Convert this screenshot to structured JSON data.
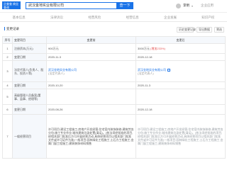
{
  "brand": {
    "logo_text": "企查查 商业查询",
    "accent": "#1a73e8"
  },
  "search": {
    "value": "武汉金地实业有限公司",
    "button_label": "查一下"
  },
  "user": {
    "name": "李明",
    "extra": "企业应用"
  },
  "tabs": [
    "基本信息",
    "法律诉讼",
    "经营风险",
    "经营信息",
    "企业发展",
    "知识产权"
  ],
  "section": {
    "title": "变更记录",
    "buttons": {
      "history": "历史变更记录",
      "export": "导出数据",
      "filter": "筛选"
    }
  },
  "table": {
    "headers": [
      "序号",
      "变更项目",
      "变更前",
      "变更后"
    ],
    "rows": [
      {
        "num": "1",
        "item": "注册资本(万元)",
        "before": "900万元",
        "after": "3000万元",
        "after_note": "(增加233%)"
      },
      {
        "num": "2",
        "item": "变更日期",
        "before": "2020-11-3",
        "after": "2020-12-18"
      },
      {
        "num": "3",
        "item": "法定代表人(负责人、股东、投资人等)",
        "before_link": "武汉金地实业有限公司",
        "before_sub": "(法定代表人)",
        "after_link": "武汉金地实业有限公司",
        "after_sub": "(法定代表人)"
      },
      {
        "num": "4",
        "item": "变更日期",
        "before": "2020-10-20",
        "after": "2020-11-3"
      },
      {
        "num": "5",
        "item": "高级管理人员备案(董事、监事、经理等)",
        "before": "",
        "after": ""
      },
      {
        "num": "6",
        "item": "变更日期",
        "before": "2020-08-26",
        "after": "2020-12-18"
      },
      {
        "num": "7",
        "item": "一般经营项目",
        "before": "许可项目:建设工程施工;房地产开发经营;住宅室内装饰装修;建筑劳务分包;施工专业作业;城市建筑垃圾处置(清运)。(依法须经批准的项目,经相关部门批准后方可开展经营活动,具体经营项目以相关部门批准文件或许可证件为准)一般项目:园林绿化工程施工;土石方工程施工;金属门窗工程施工;建筑装饰材料销售",
        "after": "许可项目:建设工程施工;房地产开发经营;住宅室内装饰装修;建筑劳务分包;施工专业作业;城市建筑垃圾处置(清运)。(依法须经批准的项目,经相关部门批准后方可开展经营活动,具体经营项目以相关部门批准文件或许可证件为准)一般项目:园林绿化工程施工;土石方工程施工;金属门窗工程施工;建筑装饰材料销售"
      }
    ]
  }
}
